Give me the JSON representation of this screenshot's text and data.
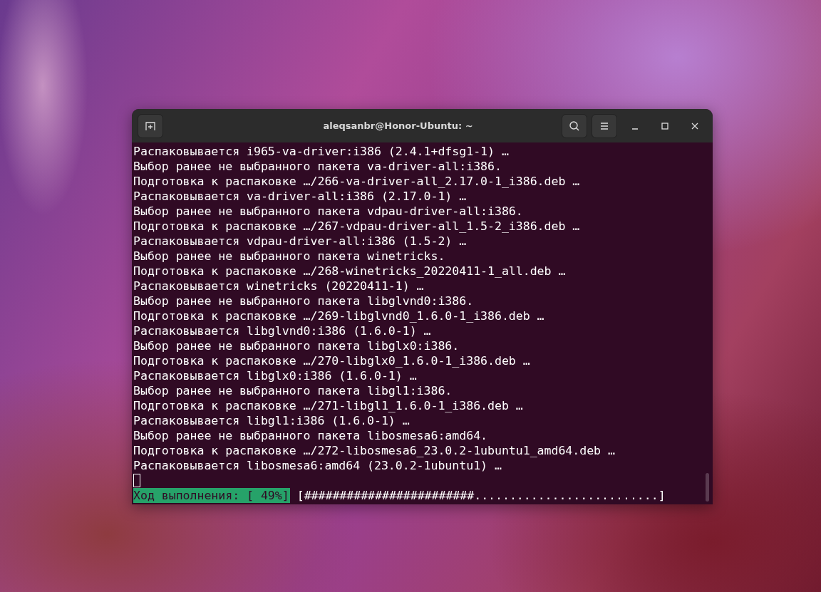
{
  "window": {
    "title": "aleqsanbr@Honor-Ubuntu: ~"
  },
  "lines": [
    "Распаковывается i965-va-driver:i386 (2.4.1+dfsg1-1) …",
    "Выбор ранее не выбранного пакета va-driver-all:i386.",
    "Подготовка к распаковке …/266-va-driver-all_2.17.0-1_i386.deb …",
    "Распаковывается va-driver-all:i386 (2.17.0-1) …",
    "Выбор ранее не выбранного пакета vdpau-driver-all:i386.",
    "Подготовка к распаковке …/267-vdpau-driver-all_1.5-2_i386.deb …",
    "Распаковывается vdpau-driver-all:i386 (1.5-2) …",
    "Выбор ранее не выбранного пакета winetricks.",
    "Подготовка к распаковке …/268-winetricks_20220411-1_all.deb …",
    "Распаковывается winetricks (20220411-1) …",
    "Выбор ранее не выбранного пакета libglvnd0:i386.",
    "Подготовка к распаковке …/269-libglvnd0_1.6.0-1_i386.deb …",
    "Распаковывается libglvnd0:i386 (1.6.0-1) …",
    "Выбор ранее не выбранного пакета libglx0:i386.",
    "Подготовка к распаковке …/270-libglx0_1.6.0-1_i386.deb …",
    "Распаковывается libglx0:i386 (1.6.0-1) …",
    "Выбор ранее не выбранного пакета libgl1:i386.",
    "Подготовка к распаковке …/271-libgl1_1.6.0-1_i386.deb …",
    "Распаковывается libgl1:i386 (1.6.0-1) …",
    "Выбор ранее не выбранного пакета libosmesa6:amd64.",
    "Подготовка к распаковке …/272-libosmesa6_23.0.2-1ubuntu1_amd64.deb …",
    "Распаковывается libosmesa6:amd64 (23.0.2-1ubuntu1) …"
  ],
  "progress": {
    "label": "Ход выполнения: [ 49%]",
    "bar": "[########################..........................]"
  }
}
